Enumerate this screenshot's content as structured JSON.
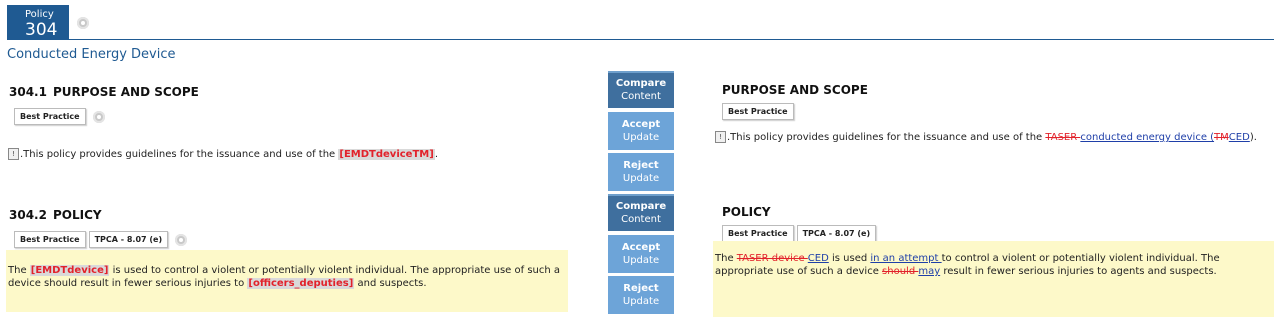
{
  "header": {
    "policy_label": "Policy",
    "policy_number": "304",
    "title": "Conducted Energy Device"
  },
  "left": {
    "s1": {
      "number": "304.1",
      "heading": "PURPOSE AND SCOPE",
      "tag": "Best Practice",
      "text_before": ".This policy provides guidelines for the issuance and use of the ",
      "var": "[EMDTdeviceTM]",
      "text_after": "."
    },
    "s2": {
      "number": "304.2",
      "heading": "POLICY",
      "tag1": "Best Practice",
      "tag2": "TPCA - 8.07 (e)",
      "t1": "The ",
      "var1": "[EMDTdevice]",
      "t2": " is used to control a violent or potentially violent individual. The appropriate use of such a device should result in fewer serious injuries to ",
      "var2": "[officers_deputies]",
      "t3": " and suspects."
    }
  },
  "middle": {
    "compare_1": "Compare",
    "compare_2": "Content",
    "accept_1": "Accept",
    "accept_2": "Update",
    "reject_1": "Reject",
    "reject_2": "Update"
  },
  "right": {
    "s1": {
      "heading": "PURPOSE AND SCOPE",
      "tag": "Best Practice",
      "t1": ".This policy provides guidelines for the issuance and use of the ",
      "del1": "TASER ",
      "ins1": "conducted energy device (",
      "del2": "TM",
      "ins2": "CED",
      "t2": ")."
    },
    "s2": {
      "heading": "POLICY",
      "tag1": "Best Practice",
      "tag2": "TPCA - 8.07 (e)",
      "t1": "The ",
      "del1": "TASER device ",
      "ins1": "CED",
      "t2": " is used ",
      "ins2": "in an attempt ",
      "t3": "to control a violent or potentially violent individual. The appropriate use of such a device ",
      "del2": "should ",
      "ins3": "may",
      "t4": " result in fewer serious injuries to agents and suspects."
    }
  },
  "colors": {
    "brand": "#1f5a92",
    "highlight": "#fdf9c9",
    "variable_red": "#e2222b",
    "insert_blue": "#1f3fa8"
  }
}
